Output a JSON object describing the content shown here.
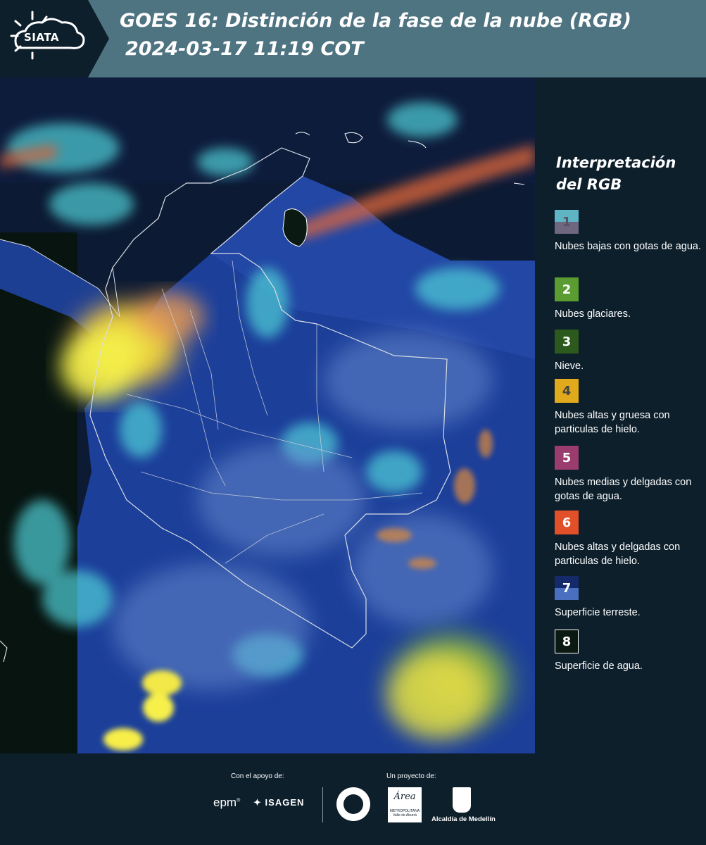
{
  "header": {
    "logo_text": "SIATA",
    "title_line1": "GOES 16: Distinción de la fase de la nube (RGB)",
    "title_line2": "2024-03-17 11:19 COT",
    "background_color": "#4e7381"
  },
  "legend": {
    "title": "Interpretación del RGB",
    "items": [
      {
        "number": "1",
        "description": "Nubes bajas con gotas de agua.",
        "color_top": "#5fb5c4",
        "color_bottom": "#6f6680",
        "number_color": "#555566"
      },
      {
        "number": "2",
        "description": "Nubes glaciares.",
        "color": "#5a9c31",
        "number_color": "#ffffff"
      },
      {
        "number": "3",
        "description": "Nieve.",
        "color": "#2c5a1c",
        "number_color": "#ffffff"
      },
      {
        "number": "4",
        "description": "Nubes altas y gruesa con particulas de hielo.",
        "color": "#e1aa1c",
        "number_color": "#444444"
      },
      {
        "number": "5",
        "description": "Nubes medias y delgadas con gotas de agua.",
        "color": "#9a3d6e",
        "number_color": "#ffffff"
      },
      {
        "number": "6",
        "description": "Nubes altas y delgadas con particulas de hielo.",
        "color": "#e2502a",
        "number_color": "#ffffff"
      },
      {
        "number": "7",
        "description": "Superficie terreste.",
        "color_top": "#142a6b",
        "color_bottom": "#4a6fc1",
        "number_color": "#ffffff"
      },
      {
        "number": "8",
        "description": "Superficie de agua.",
        "color": "#0a1a12",
        "number_color": "#ffffff"
      }
    ]
  },
  "footer": {
    "support_label": "Con el apoyo de:",
    "project_label": "Un proyecto de:",
    "epm_logo_text": "epm",
    "isagen_logo_text": "ISAGEN",
    "amva_logo_text": "Área",
    "amva_logo_subtext": "METROPOLITANA Valle de Aburrá",
    "medellin_label": "Alcaldía de Medellín"
  }
}
